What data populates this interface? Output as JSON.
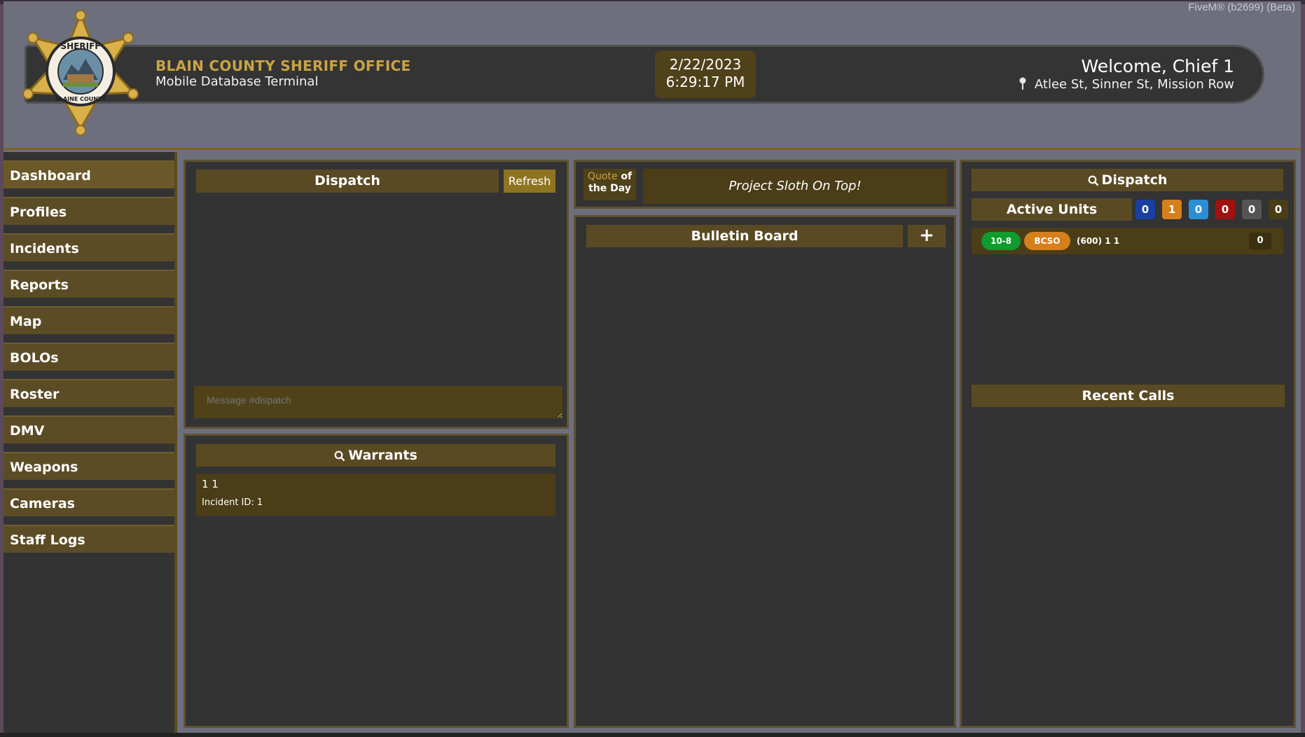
{
  "window": {
    "tag": "FiveM® (b2699) (Beta)"
  },
  "header": {
    "org_name": "BLAIN COUNTY SHERIFF OFFICE",
    "org_sub": "Mobile Database Terminal",
    "date": "2/22/2023",
    "time": "6:29:17 PM",
    "welcome": "Welcome, Chief 1",
    "location": "Atlee St, Sinner St, Mission Row",
    "badge_top_text": "SHERIFF",
    "badge_bottom_text": "BLAINE COUNTY"
  },
  "sidebar": {
    "items": [
      {
        "label": "Dashboard"
      },
      {
        "label": "Profiles"
      },
      {
        "label": "Incidents"
      },
      {
        "label": "Reports"
      },
      {
        "label": "Map"
      },
      {
        "label": "BOLOs"
      },
      {
        "label": "Roster"
      },
      {
        "label": "DMV"
      },
      {
        "label": "Weapons"
      },
      {
        "label": "Cameras"
      },
      {
        "label": "Staff Logs"
      }
    ]
  },
  "dispatch": {
    "title": "Dispatch",
    "refresh_label": "Refresh",
    "message_placeholder": "Message #dispatch"
  },
  "warrants": {
    "title": "Warrants",
    "items": [
      {
        "name": "1 1",
        "incident": "Incident ID: 1"
      }
    ]
  },
  "quote": {
    "label_part1": "Quote",
    "label_part2": "of",
    "label_part3": "the Day",
    "text": "Project Sloth On Top!"
  },
  "bulletin": {
    "title": "Bulletin Board",
    "add_label": "+"
  },
  "right_dispatch": {
    "title": "Dispatch",
    "active_units_label": "Active Units",
    "counts": [
      {
        "value": "0",
        "color": "#1b3fa0"
      },
      {
        "value": "1",
        "color": "#d67f1d"
      },
      {
        "value": "0",
        "color": "#2a8fd6"
      },
      {
        "value": "0",
        "color": "#a01010"
      },
      {
        "value": "0",
        "color": "#555555"
      },
      {
        "value": "0",
        "color": "#4a3d17"
      }
    ],
    "units": [
      {
        "status": "10-8",
        "status_color": "#0f9b2e",
        "dept": "BCSO",
        "dept_color": "#d67f1d",
        "name": "(600) 1 1",
        "count": "0"
      }
    ],
    "recent_calls_title": "Recent Calls"
  }
}
